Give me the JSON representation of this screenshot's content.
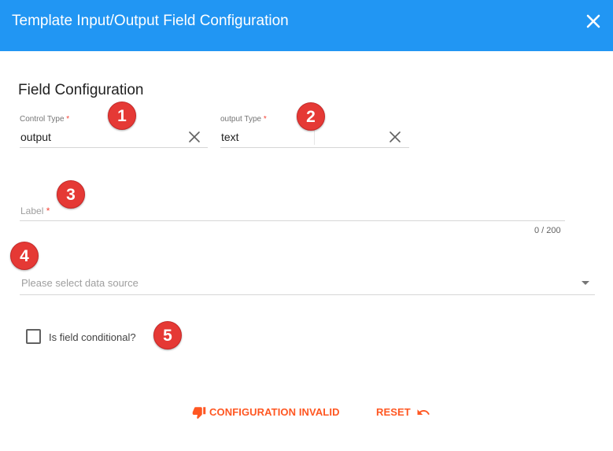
{
  "dialog": {
    "title": "Template Input/Output Field Configuration",
    "close_icon": "close-icon"
  },
  "section": {
    "title": "Field Configuration"
  },
  "control_type": {
    "label": "Control Type",
    "required_mark": "*",
    "value": "output"
  },
  "output_type": {
    "label": "output Type",
    "required_mark": "*",
    "value": "text"
  },
  "label_field": {
    "placeholder": "Label",
    "required_mark": "*",
    "counter": "0 / 200"
  },
  "data_source": {
    "placeholder": "Please select data source"
  },
  "conditional": {
    "label": "Is field conditional?",
    "checked": false
  },
  "badges": [
    "1",
    "2",
    "3",
    "4",
    "5"
  ],
  "actions": {
    "status_label": "CONFIGURATION INVALID",
    "status_icon": "thumbs-down-icon",
    "reset_label": "RESET",
    "reset_icon": "undo-icon"
  },
  "colors": {
    "header": "#2196f3",
    "accent_action": "#ff5722",
    "badge": "#e53935",
    "required": "#f44336"
  }
}
